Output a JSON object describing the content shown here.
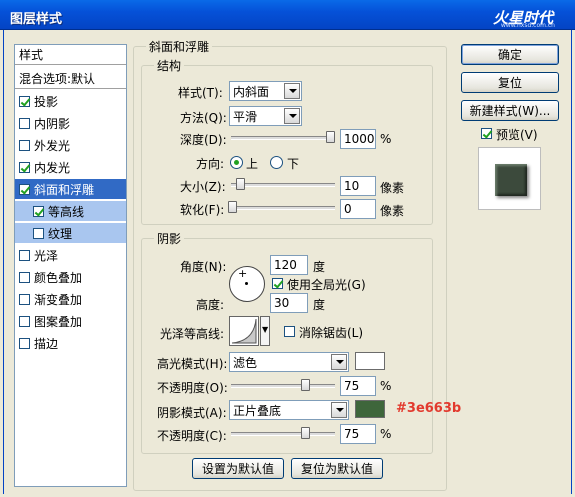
{
  "window": {
    "title": "图层样式",
    "logo_text": "火星时代",
    "logo_url": "www.hxsd.com.cn"
  },
  "stylelist": {
    "header": "样式",
    "blend": "混合选项:默认",
    "items": [
      {
        "label": "投影",
        "checked": true
      },
      {
        "label": "内阴影",
        "checked": false
      },
      {
        "label": "外发光",
        "checked": false
      },
      {
        "label": "内发光",
        "checked": true
      },
      {
        "label": "斜面和浮雕",
        "checked": true
      },
      {
        "label": "等高线",
        "checked": true
      },
      {
        "label": "纹理",
        "checked": false
      },
      {
        "label": "光泽",
        "checked": false
      },
      {
        "label": "颜色叠加",
        "checked": false
      },
      {
        "label": "渐变叠加",
        "checked": false
      },
      {
        "label": "图案叠加",
        "checked": false
      },
      {
        "label": "描边",
        "checked": false
      }
    ]
  },
  "bevel": {
    "group_title": "斜面和浮雕",
    "structure": {
      "title": "结构",
      "style_label": "样式(T):",
      "style_value": "内斜面",
      "technique_label": "方法(Q):",
      "technique_value": "平滑",
      "depth_label": "深度(D):",
      "depth_value": "1000",
      "depth_unit": "%",
      "depth_level": 1.0,
      "direction_label": "方向:",
      "dir_up": "上",
      "dir_down": "下",
      "dir_selected": "up",
      "size_label": "大小(Z):",
      "size_value": "10",
      "size_unit": "像素",
      "soften_label": "软化(F):",
      "soften_value": "0",
      "soften_unit": "像素"
    },
    "shading": {
      "title": "阴影",
      "angle_label": "角度(N):",
      "angle_value": "120",
      "angle_unit": "度",
      "global_light_label": "使用全局光(G)",
      "global_light_checked": true,
      "altitude_label": "高度:",
      "altitude_value": "30",
      "altitude_unit": "度",
      "gloss_contour_label": "光泽等高线:",
      "antialias_label": "消除锯齿(L)",
      "antialias_checked": false,
      "highlight_mode_label": "高光模式(H):",
      "highlight_mode_value": "滤色",
      "highlight_color": "#ffffff",
      "highlight_opacity_label": "不透明度(O):",
      "highlight_opacity_value": "75",
      "highlight_opacity_unit": "%",
      "shadow_mode_label": "阴影模式(A):",
      "shadow_mode_value": "正片叠底",
      "shadow_color": "#3e663b",
      "shadow_color_note": "#3e663b",
      "shadow_opacity_label": "不透明度(C):",
      "shadow_opacity_value": "75",
      "shadow_opacity_unit": "%"
    },
    "make_default_label": "设置为默认值",
    "reset_default_label": "复位为默认值"
  },
  "actions": {
    "ok_label": "确定",
    "reset_label": "复位",
    "new_style_label": "新建样式(W)...",
    "preview_label": "预览(V)",
    "preview_checked": true
  }
}
